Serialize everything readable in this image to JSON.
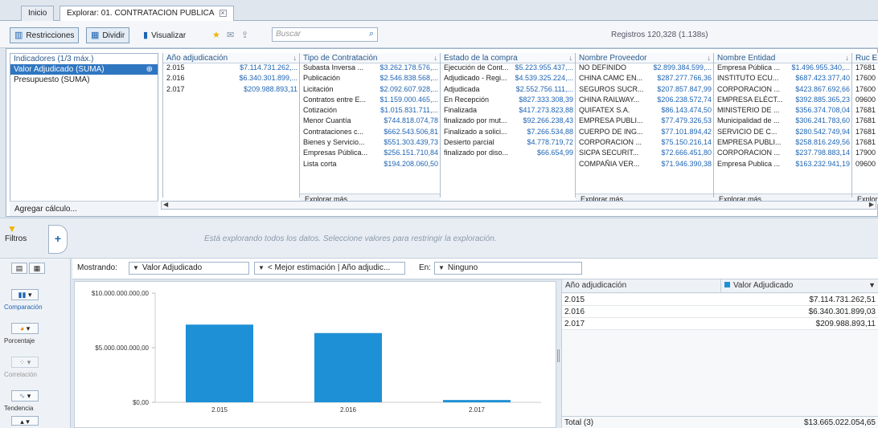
{
  "tabs": [
    {
      "label": "Inicio"
    },
    {
      "label": "Explorar: 01. CONTRATACION PUBLICA"
    }
  ],
  "toolbar": {
    "restricciones": "Restricciones",
    "dividir": "Dividir",
    "visualizar": "Visualizar",
    "search_placeholder": "Buscar",
    "registros": "Registros 120,328 (1.138s)"
  },
  "indicators": {
    "header": "Indicadores (1/3 máx.)",
    "items": [
      "Valor Adjudicado (SUMA)",
      "Presupuesto (SUMA)"
    ],
    "add_calc": "Agregar cálculo..."
  },
  "columns": [
    {
      "header": "Año adjudicación",
      "rows": [
        {
          "k": "2.015",
          "v": "$7.114.731.262,..."
        },
        {
          "k": "2.016",
          "v": "$6.340.301.899,..."
        },
        {
          "k": "2.017",
          "v": "$209.988.893,11"
        }
      ],
      "more": ""
    },
    {
      "header": "Tipo de Contratación",
      "rows": [
        {
          "k": "Subasta Inversa ...",
          "v": "$3.262.178.576,..."
        },
        {
          "k": "Publicación",
          "v": "$2.546.838.568,..."
        },
        {
          "k": "Licitación",
          "v": "$2.092.607.928,..."
        },
        {
          "k": "Contratos entre E...",
          "v": "$1.159.000.465,..."
        },
        {
          "k": "Cotización",
          "v": "$1.015.831.711,..."
        },
        {
          "k": "Menor Cuantía",
          "v": "$744.818.074,78"
        },
        {
          "k": "Contrataciones c...",
          "v": "$662.543.506,81"
        },
        {
          "k": "Bienes y Servicio...",
          "v": "$551.303.439,73"
        },
        {
          "k": "Empresas Pública...",
          "v": "$256.151.710,84"
        },
        {
          "k": "Lista corta",
          "v": "$194.208.060,50"
        }
      ],
      "more": "Explorar más..."
    },
    {
      "header": "Estado de la compra",
      "rows": [
        {
          "k": "Ejecución de Cont...",
          "v": "$5.223.955.437,..."
        },
        {
          "k": "Adjudicado - Regi...",
          "v": "$4.539.325.224,..."
        },
        {
          "k": "Adjudicada",
          "v": "$2.552.756.111,..."
        },
        {
          "k": "En Recepción",
          "v": "$827.333.308,39"
        },
        {
          "k": "Finalizada",
          "v": "$417.273.823,88"
        },
        {
          "k": "finalizado por mut...",
          "v": "$92.266.238,43"
        },
        {
          "k": "Finalizado a solici...",
          "v": "$7.266.534,88"
        },
        {
          "k": "Desierto parcial",
          "v": "$4.778.719,72"
        },
        {
          "k": "finalizado por diso...",
          "v": "$66.654,99"
        }
      ],
      "more": ""
    },
    {
      "header": "Nombre Proveedor",
      "rows": [
        {
          "k": "NO DEFINIDO",
          "v": "$2.899.384.599,..."
        },
        {
          "k": "CHINA CAMC EN...",
          "v": "$287.277.766,36"
        },
        {
          "k": "SEGUROS SUCR...",
          "v": "$207.857.847,99"
        },
        {
          "k": "CHINA RAILWAY...",
          "v": "$206.238.572,74"
        },
        {
          "k": "QUIFATEX S.A.",
          "v": "$86.143.474,50"
        },
        {
          "k": "EMPRESA PUBLI...",
          "v": "$77.479.326,53"
        },
        {
          "k": "CUERPO DE ING...",
          "v": "$77.101.894,42"
        },
        {
          "k": "CORPORACION ...",
          "v": "$75.150.216,14"
        },
        {
          "k": "SICPA SECURIT...",
          "v": "$72.666.451,80"
        },
        {
          "k": "COMPAÑIA VER...",
          "v": "$71.946.390,38"
        }
      ],
      "more": "Explorar más..."
    },
    {
      "header": "Nombre Entidad",
      "rows": [
        {
          "k": "Empresa Pública ...",
          "v": "$1.496.955.340,..."
        },
        {
          "k": "INSTITUTO ECU...",
          "v": "$687.423.377,40"
        },
        {
          "k": "CORPORACION ...",
          "v": "$423.867.692,66"
        },
        {
          "k": "EMPRESA ELÉCT...",
          "v": "$392.885.365,23"
        },
        {
          "k": "MINISTERIO DE ...",
          "v": "$356.374.708,04"
        },
        {
          "k": "Municipalidad de ...",
          "v": "$306.241.783,60"
        },
        {
          "k": "SERVICIO DE C...",
          "v": "$280.542.749,94"
        },
        {
          "k": "EMPRESA PUBLI...",
          "v": "$258.816.249,56"
        },
        {
          "k": "CORPORACION ...",
          "v": "$237.798.883,14"
        },
        {
          "k": "Empresa Publica ...",
          "v": "$163.232.941,19"
        }
      ],
      "more": "Explorar más..."
    },
    {
      "header": "Ruc En",
      "rows": [
        {
          "k": "17681",
          "v": ""
        },
        {
          "k": "17600",
          "v": ""
        },
        {
          "k": "17600",
          "v": ""
        },
        {
          "k": "09600",
          "v": ""
        },
        {
          "k": "17681",
          "v": ""
        },
        {
          "k": "17681",
          "v": ""
        },
        {
          "k": "17681",
          "v": ""
        },
        {
          "k": "17681",
          "v": ""
        },
        {
          "k": "17900",
          "v": ""
        },
        {
          "k": "09600",
          "v": ""
        }
      ],
      "more": "Explor"
    }
  ],
  "filters": {
    "label": "Filtros",
    "message": "Está explorando todos los datos. Seleccione valores para restringir la exploración."
  },
  "viz_types": {
    "comparacion": "Comparación",
    "porcentaje": "Porcentaje",
    "correlacion": "Correlación",
    "tendencia": "Tendencia"
  },
  "mostrando": {
    "label": "Mostrando:",
    "measure": "Valor Adjudicado",
    "best": "< Mejor estimación | Año adjudic...",
    "en_label": "En:",
    "en_value": "Ninguno"
  },
  "chart_data": {
    "type": "bar",
    "categories": [
      "2.015",
      "2.016",
      "2.017"
    ],
    "values": [
      7114731262.51,
      6340301899.03,
      209988893.11
    ],
    "ylim": [
      0,
      10000000000
    ],
    "yticks": [
      {
        "v": 0,
        "label": "$0,00"
      },
      {
        "v": 5000000000,
        "label": "$5.000.000.000,00"
      },
      {
        "v": 10000000000,
        "label": "$10.000.000.000,00"
      }
    ],
    "color": "#1e90d6",
    "grid": false
  },
  "table": {
    "col1": "Año adjudicación",
    "col2": "Valor Adjudicado",
    "rows": [
      {
        "year": "2.015",
        "value": "$7.114.731.262,51"
      },
      {
        "year": "2.016",
        "value": "$6.340.301.899,03"
      },
      {
        "year": "2.017",
        "value": "$209.988.893,11"
      }
    ],
    "total_label": "Total (3)",
    "total_value": "$13.665.022.054,65"
  }
}
